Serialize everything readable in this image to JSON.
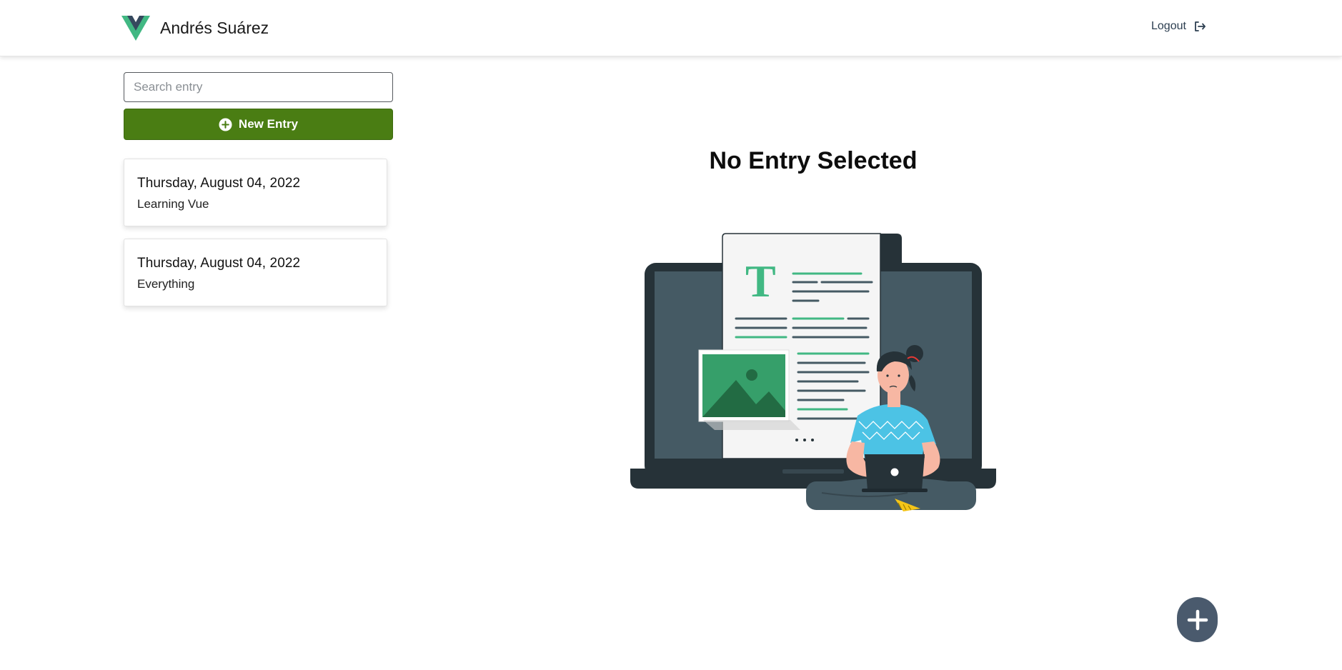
{
  "header": {
    "user_name": "Andrés Suárez",
    "logout_label": "Logout",
    "logo_icon": "vue-logo-icon",
    "logout_icon": "sign-out-icon"
  },
  "sidebar": {
    "search_placeholder": "Search entry",
    "search_value": "",
    "new_entry_label": "New Entry",
    "new_entry_icon": "plus-circle-icon",
    "entries": [
      {
        "date": "Thursday, August 04, 2022",
        "title": "Learning Vue"
      },
      {
        "date": "Thursday, August 04, 2022",
        "title": "Everything"
      }
    ]
  },
  "main": {
    "empty_title": "No Entry Selected",
    "fab_icon": "plus-icon"
  },
  "colors": {
    "brand_green": "#41b883",
    "brand_dark": "#35495e",
    "button_green": "#4a7d13",
    "fab": "#4a5a6d"
  }
}
